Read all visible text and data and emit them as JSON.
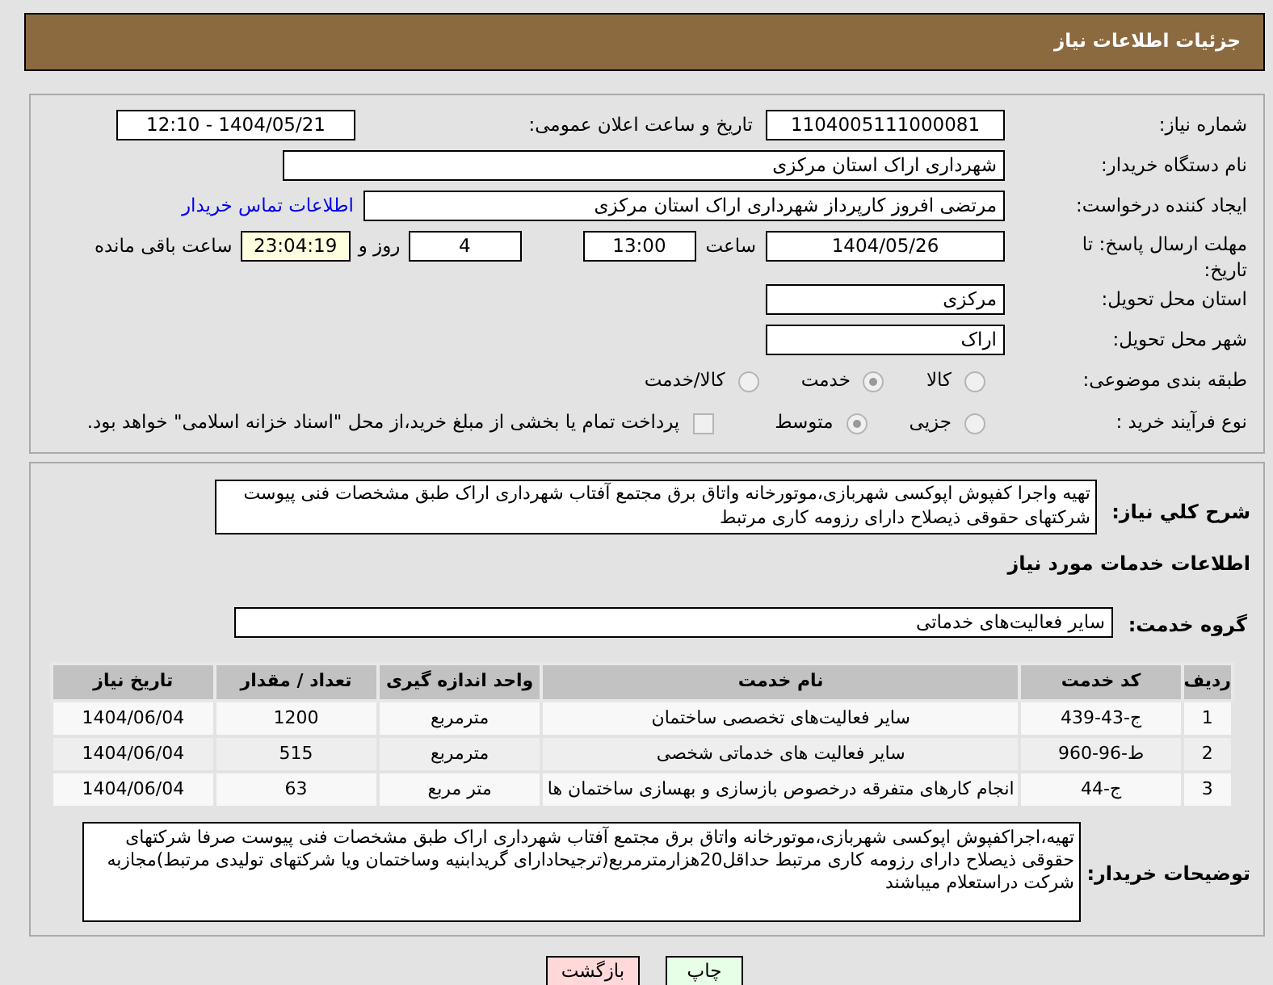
{
  "header": {
    "title": "جزئیات اطلاعات نیاز"
  },
  "need_number": {
    "label": "شماره نیاز:",
    "value": "1104005111000081"
  },
  "announce": {
    "label": "تاریخ و ساعت اعلان عمومی:",
    "value": "1404/05/21 - 12:10"
  },
  "buyer_org": {
    "label": "نام دستگاه خریدار:",
    "value": "شهرداری اراک استان مرکزی"
  },
  "creator": {
    "label": "ایجاد کننده درخواست:",
    "value": "مرتضی افروز کارپرداز شهرداری اراک استان مرکزی",
    "link": "اطلاعات تماس خریدار"
  },
  "deadline": {
    "label": "مهلت ارسال پاسخ: تا تاریخ:",
    "date": "1404/05/26",
    "time_label": "ساعت",
    "time": "13:00",
    "days": "4",
    "days_label": "روز و",
    "remaining": "23:04:19",
    "remaining_label": "ساعت باقی مانده"
  },
  "province": {
    "label": "استان محل تحویل:",
    "value": "مرکزی"
  },
  "city": {
    "label": "شهر محل تحویل:",
    "value": "اراک"
  },
  "category": {
    "label": "طبقه بندی موضوعی:",
    "options": [
      {
        "label": "کالا",
        "selected": false
      },
      {
        "label": "خدمت",
        "selected": true
      },
      {
        "label": "کالا/خدمت",
        "selected": false
      }
    ]
  },
  "process": {
    "label": "نوع فرآیند خرید :",
    "options": [
      {
        "label": "جزیی",
        "selected": false
      },
      {
        "label": "متوسط",
        "selected": true
      }
    ],
    "payment": {
      "label": "پرداخت تمام یا بخشی از مبلغ خرید،از محل \"اسناد خزانه اسلامی\" خواهد بود.",
      "checked": false
    }
  },
  "summary": {
    "label": "شرح کلي نیاز:",
    "value": "تهیه واجرا کفپوش اپوکسی شهربازی،موتورخانه واتاق برق مجتمع آفتاب شهرداری اراک طبق مشخصات فنی پیوست شرکتهای حقوقی ذیصلاح دارای رزومه کاری مرتبط"
  },
  "services_heading": "اطلاعات خدمات مورد نیاز",
  "service_group": {
    "label": "گروه خدمت:",
    "value": "سایر فعالیت‌های خدماتی"
  },
  "table": {
    "columns": [
      "ردیف",
      "کد خدمت",
      "نام خدمت",
      "واحد اندازه گیری",
      "تعداد / مقدار",
      "تاریخ نیاز"
    ],
    "rows": [
      [
        "1",
        "ج-43-439",
        "سایر فعالیت‌های تخصصی ساختمان",
        "مترمربع",
        "1200",
        "1404/06/04"
      ],
      [
        "2",
        "ط-96-960",
        "سایر فعالیت های خدماتی شخصی",
        "مترمربع",
        "515",
        "1404/06/04"
      ],
      [
        "3",
        "ج-44",
        "انجام کارهای متفرقه درخصوص بازسازی و بهسازی ساختمان ها",
        "متر مربع",
        "63",
        "1404/06/04"
      ]
    ]
  },
  "buyer_notes": {
    "label": "توضیحات خریدار:",
    "value": "تهیه،اجراکفپوش اپوکسی شهربازی،موتورخانه واتاق برق مجتمع آفتاب شهرداری اراک طبق مشخصات فنی پیوست صرفا شرکتهای حقوقی ذیصلاح دارای رزومه کاری مرتبط حداقل20هزارمترمربع(ترجیحادارای گریدابنیه وساختمان ویا شرکتهای تولیدی مرتبط)مجازبه شرکت دراستعلام میباشند"
  },
  "buttons": [
    {
      "kind": "print",
      "label": "چاپ"
    },
    {
      "kind": "back",
      "label": "بازگشت"
    }
  ]
}
